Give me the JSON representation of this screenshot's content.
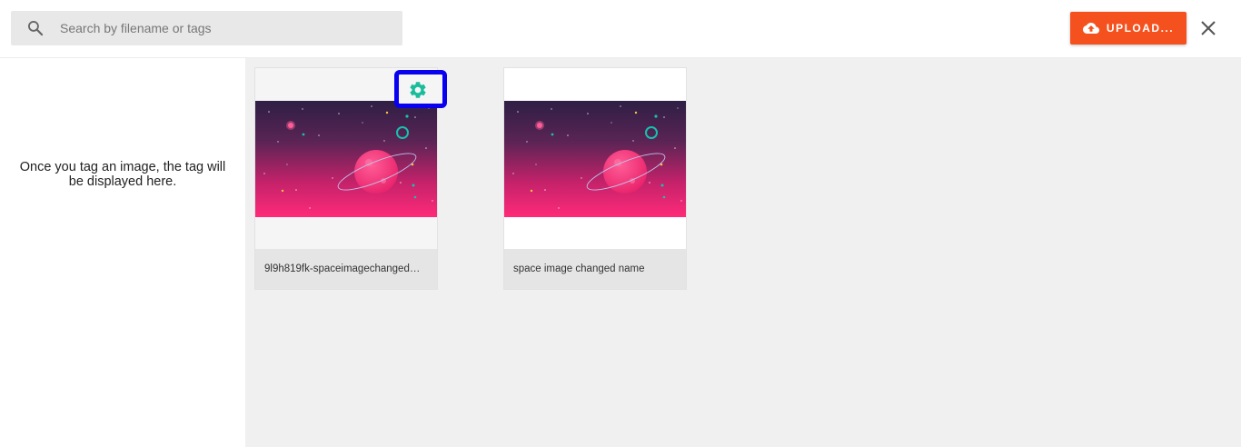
{
  "search": {
    "placeholder": "Search by filename or tags",
    "value": ""
  },
  "toolbar": {
    "upload_label": "UPLOAD..."
  },
  "sidebar": {
    "message": "Once you tag an image, the tag will be displayed here."
  },
  "images": [
    {
      "name": "9l9h819fk-spaceimagechanged…"
    },
    {
      "name": "space image changed name"
    }
  ],
  "colors": {
    "accent": "#f4511e",
    "gear": "#1abc9c",
    "highlight": "#0a00f0",
    "content_bg": "#f0f0f0"
  },
  "icons": [
    "search-icon",
    "cloud-upload-icon",
    "close-icon",
    "gear-icon"
  ]
}
